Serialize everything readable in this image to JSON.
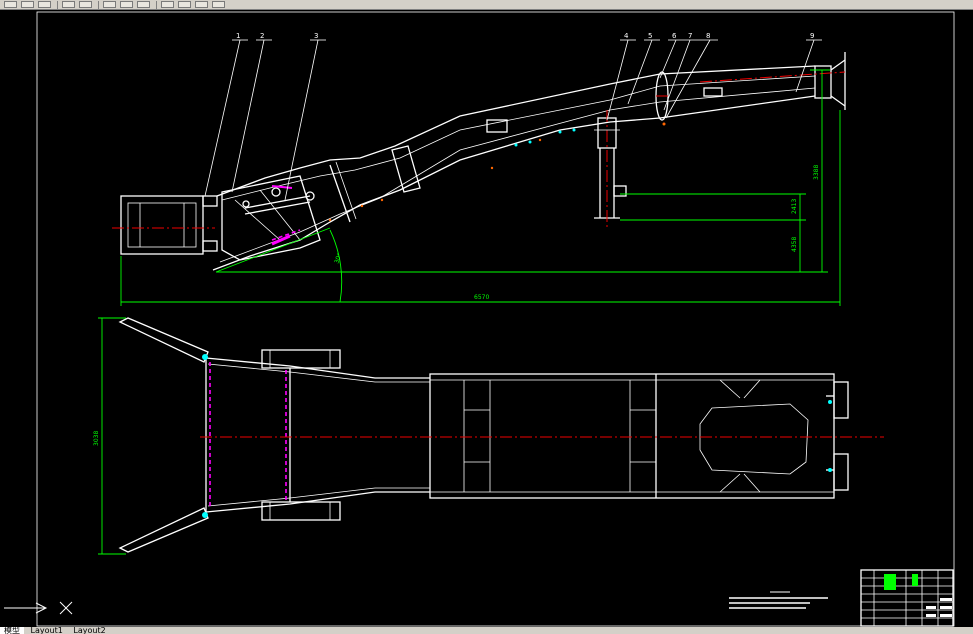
{
  "part_labels": [
    "1",
    "2",
    "3",
    "4",
    "5",
    "6",
    "7",
    "8",
    "9"
  ],
  "dimensions": {
    "overall_length": "6570",
    "height_right": "3388",
    "offset_a": "2413",
    "offset_b": "4358",
    "angle": "30°",
    "plan_width": "3038"
  },
  "layout_tabs": [
    "模型",
    "Layout1",
    "Layout2"
  ],
  "colors": {
    "background": "#000000",
    "outline": "#ffffff",
    "dimension": "#00ff00",
    "centerline": "#ee0000",
    "hidden": "#ff00ff"
  }
}
